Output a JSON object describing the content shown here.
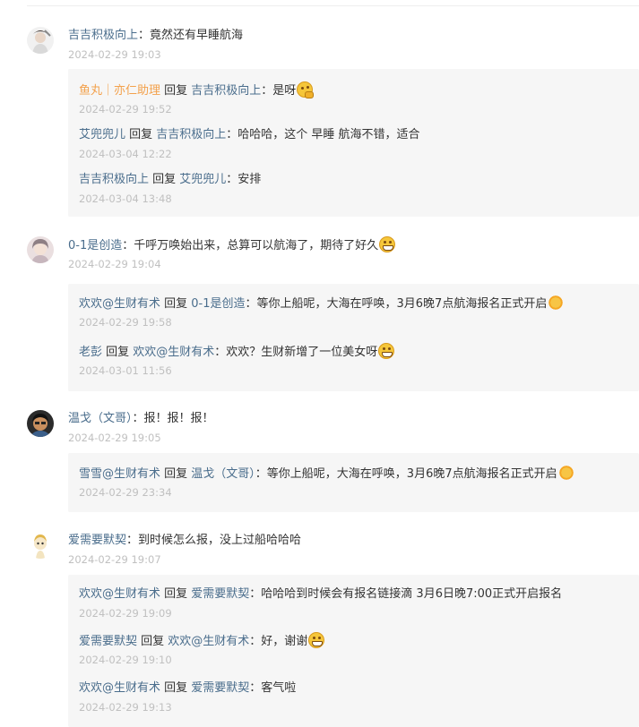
{
  "threads": [
    {
      "name": "吉吉积极向上",
      "text": "：竟然还有早睡航海",
      "time": "2024-02-29 19:03",
      "replies": [
        {
          "from": "鱼丸｜亦仁助理",
          "verb": " 回复 ",
          "to": "吉吉积极向上",
          "text": "：是呀",
          "emoji": "thinking-emoji",
          "time": "2024-02-29 19:52"
        },
        {
          "from": "艾兜兜儿",
          "verb": " 回复 ",
          "to": "吉吉积极向上",
          "text": "：哈哈哈，这个 早睡 航海不错，适合",
          "time": "2024-03-04 12:22"
        },
        {
          "from": "吉吉积极向上",
          "verb": " 回复 ",
          "to": "艾兜兜儿",
          "text": "：安排",
          "time": "2024-03-04 13:48"
        }
      ]
    },
    {
      "name": "0-1是创造",
      "text": "：千呼万唤始出来，总算可以航海了，期待了好久",
      "emoji": "grin-emoji",
      "time": "2024-02-29 19:04",
      "replies": [
        {
          "from": "欢欢@生财有术",
          "verb": " 回复 ",
          "to": "0-1是创造",
          "text": "：等你上船呢，大海在呼唤，3月6晚7点航海报名正式开启",
          "emoji": "sun-emoji",
          "time": "2024-02-29 19:58"
        },
        {
          "from": "老彭",
          "verb": " 回复 ",
          "to": "欢欢@生财有术",
          "text": "：欢欢？生财新增了一位美女呀",
          "emoji": "grin-emoji",
          "time": "2024-03-01 11:56"
        }
      ]
    },
    {
      "name": "温戈（文哥）",
      "text": "：报！报！报！",
      "time": "2024-02-29 19:05",
      "replies": [
        {
          "from": "雪雪@生财有术",
          "verb": " 回复 ",
          "to": "温戈（文哥）",
          "text": "：等你上船呢，大海在呼唤，3月6晚7点航海报名正式开启",
          "emoji": "sun-emoji",
          "time": "2024-02-29 23:34"
        }
      ]
    },
    {
      "name": "爱需要默契",
      "text": "：到时候怎么报，没上过船哈哈哈",
      "time": "2024-02-29 19:07",
      "replies": [
        {
          "from": "欢欢@生财有术",
          "verb": " 回复 ",
          "to": "爱需要默契",
          "text": "：哈哈哈到时候会有报名链接滴 3月6日晚7:00正式开启报名",
          "time": "2024-02-29 19:09"
        },
        {
          "from": "爱需要默契",
          "verb": " 回复 ",
          "to": "欢欢@生财有术",
          "text": "：好，谢谢",
          "emoji": "grin-emoji",
          "time": "2024-02-29 19:10"
        },
        {
          "from": "欢欢@生财有术",
          "verb": " 回复 ",
          "to": "爱需要默契",
          "text": "：客气啦",
          "time": "2024-02-29 19:13"
        }
      ]
    }
  ]
}
